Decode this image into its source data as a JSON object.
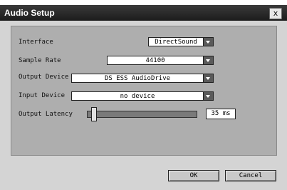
{
  "window": {
    "title": "Audio Setup",
    "close_label": "x"
  },
  "form": {
    "interface": {
      "label": "Interface",
      "value": "DirectSound"
    },
    "sample_rate": {
      "label": "Sample Rate",
      "value": "44100"
    },
    "output_device": {
      "label": "Output Device",
      "value": "DS ESS AudioDrive"
    },
    "input_device": {
      "label": "Input Device",
      "value": "no device"
    },
    "output_latency": {
      "label": "Output Latency",
      "value": "35 ms",
      "slider_level": 0.03
    }
  },
  "buttons": {
    "ok": "OK",
    "cancel": "Cancel"
  }
}
